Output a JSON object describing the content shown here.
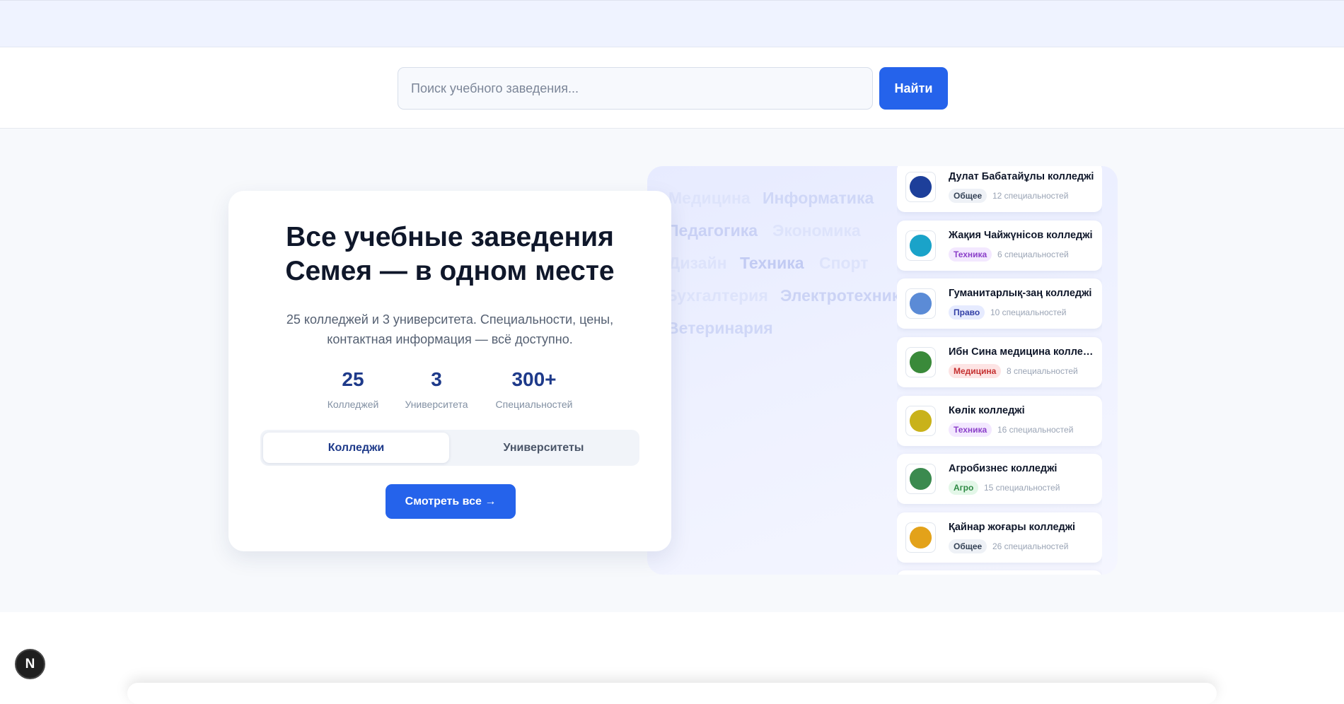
{
  "search": {
    "placeholder": "Поиск учебного заведения...",
    "button_label": "Найти"
  },
  "hero": {
    "title_line1": "Все учебные заведения",
    "title_line2": "Семея — в одном месте",
    "subtitle_line1": "25 колледжей и 3 университета. Специальности, цены,",
    "subtitle_line2": "контактная информация — всё доступно.",
    "stats": [
      {
        "value": "25",
        "label": "Колледжей"
      },
      {
        "value": "3",
        "label": "Университета"
      },
      {
        "value": "300+",
        "label": "Специальностей"
      }
    ],
    "tabs": [
      {
        "label": "Колледжи",
        "active": true
      },
      {
        "label": "Университеты",
        "active": false
      }
    ],
    "view_all_label": "Смотреть все →"
  },
  "tags": [
    {
      "text": "Медицина",
      "color": "#dde3fb"
    },
    {
      "text": "Информатика",
      "color": "#cfd7f7"
    },
    {
      "text": "Педагогика",
      "color": "#c9d1f5"
    },
    {
      "text": "Экономика",
      "color": "#dde3fb"
    },
    {
      "text": "Дизайн",
      "color": "#dde3fb"
    },
    {
      "text": "Техника",
      "color": "#c2cbf3"
    },
    {
      "text": "Спорт",
      "color": "#dde3fb"
    },
    {
      "text": "Бухгалтерия",
      "color": "#dde3fb"
    },
    {
      "text": "Электротехника",
      "color": "#cbd3f5"
    },
    {
      "text": "Ветеринария",
      "color": "#cfd7f7"
    }
  ],
  "colleges": [
    {
      "name": "Дулат Бабатайұлы колледжі",
      "badge": "Общее",
      "count": "12 специальностей",
      "badge_bg": "#eef1f6",
      "badge_color": "#334155",
      "logo_color": "#1d3f9a"
    },
    {
      "name": "Жақия Чайжүнісов колледжі",
      "badge": "Техника",
      "count": "6 специальностей",
      "badge_bg": "#f3e8ff",
      "badge_color": "#8b3fc9",
      "logo_color": "#1aa3c9"
    },
    {
      "name": "Гуманитарлық-заң колледжі",
      "badge": "Право",
      "count": "10 специальностей",
      "badge_bg": "#e6ebff",
      "badge_color": "#3340a6",
      "logo_color": "#5b8bd6"
    },
    {
      "name": "Ибн Сина медицина колледжі",
      "badge": "Медицина",
      "count": "8 специальностей",
      "badge_bg": "#fde4e4",
      "badge_color": "#c53030",
      "logo_color": "#3a8a3a"
    },
    {
      "name": "Көлік колледжі",
      "badge": "Техника",
      "count": "16 специальностей",
      "badge_bg": "#f3e8ff",
      "badge_color": "#8b3fc9",
      "logo_color": "#c9b21a"
    },
    {
      "name": "Агробизнес колледжі",
      "badge": "Агро",
      "count": "15 специальностей",
      "badge_bg": "#e3f7e8",
      "badge_color": "#2f8a45",
      "logo_color": "#3b8a4f"
    },
    {
      "name": "Қайнар жоғары колледжі",
      "badge": "Общее",
      "count": "26 специальностей",
      "badge_bg": "#eef1f6",
      "badge_color": "#334155",
      "logo_color": "#e3a21a"
    }
  ],
  "corner_badge": "N"
}
